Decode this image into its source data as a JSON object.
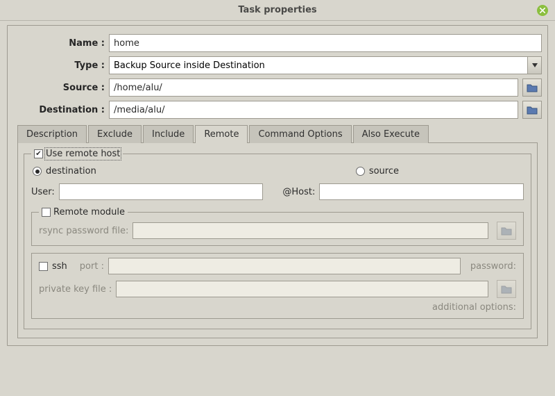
{
  "window": {
    "title": "Task properties"
  },
  "form": {
    "name_label": "Name :",
    "name_value": "home",
    "type_label": "Type :",
    "type_value": "Backup Source inside Destination",
    "source_label": "Source :",
    "source_value": "/home/alu/",
    "destination_label": "Destination :",
    "destination_value": "/media/alu/"
  },
  "tabs": {
    "description": "Description",
    "exclude": "Exclude",
    "include": "Include",
    "remote": "Remote",
    "command_options": "Command Options",
    "also_execute": "Also Execute"
  },
  "remote": {
    "use_remote_label": "Use remote host",
    "use_remote_checked": true,
    "radio_destination": "destination",
    "radio_source": "source",
    "radio_selected": "destination",
    "user_label": "User:",
    "user_value": "",
    "host_label": "@Host:",
    "host_value": "",
    "remote_module_label": "Remote module",
    "remote_module_checked": false,
    "rsync_pw_label": "rsync password file:",
    "rsync_pw_value": "",
    "ssh_label": "ssh",
    "ssh_checked": false,
    "port_label": "port :",
    "port_value": "",
    "password_label": "password:",
    "pk_label": "private key file :",
    "pk_value": "",
    "additional_label": "additional options:"
  },
  "colors": {
    "bg": "#d8d6cd",
    "border": "#9d9a90",
    "accent_green": "#8bbf3f"
  }
}
